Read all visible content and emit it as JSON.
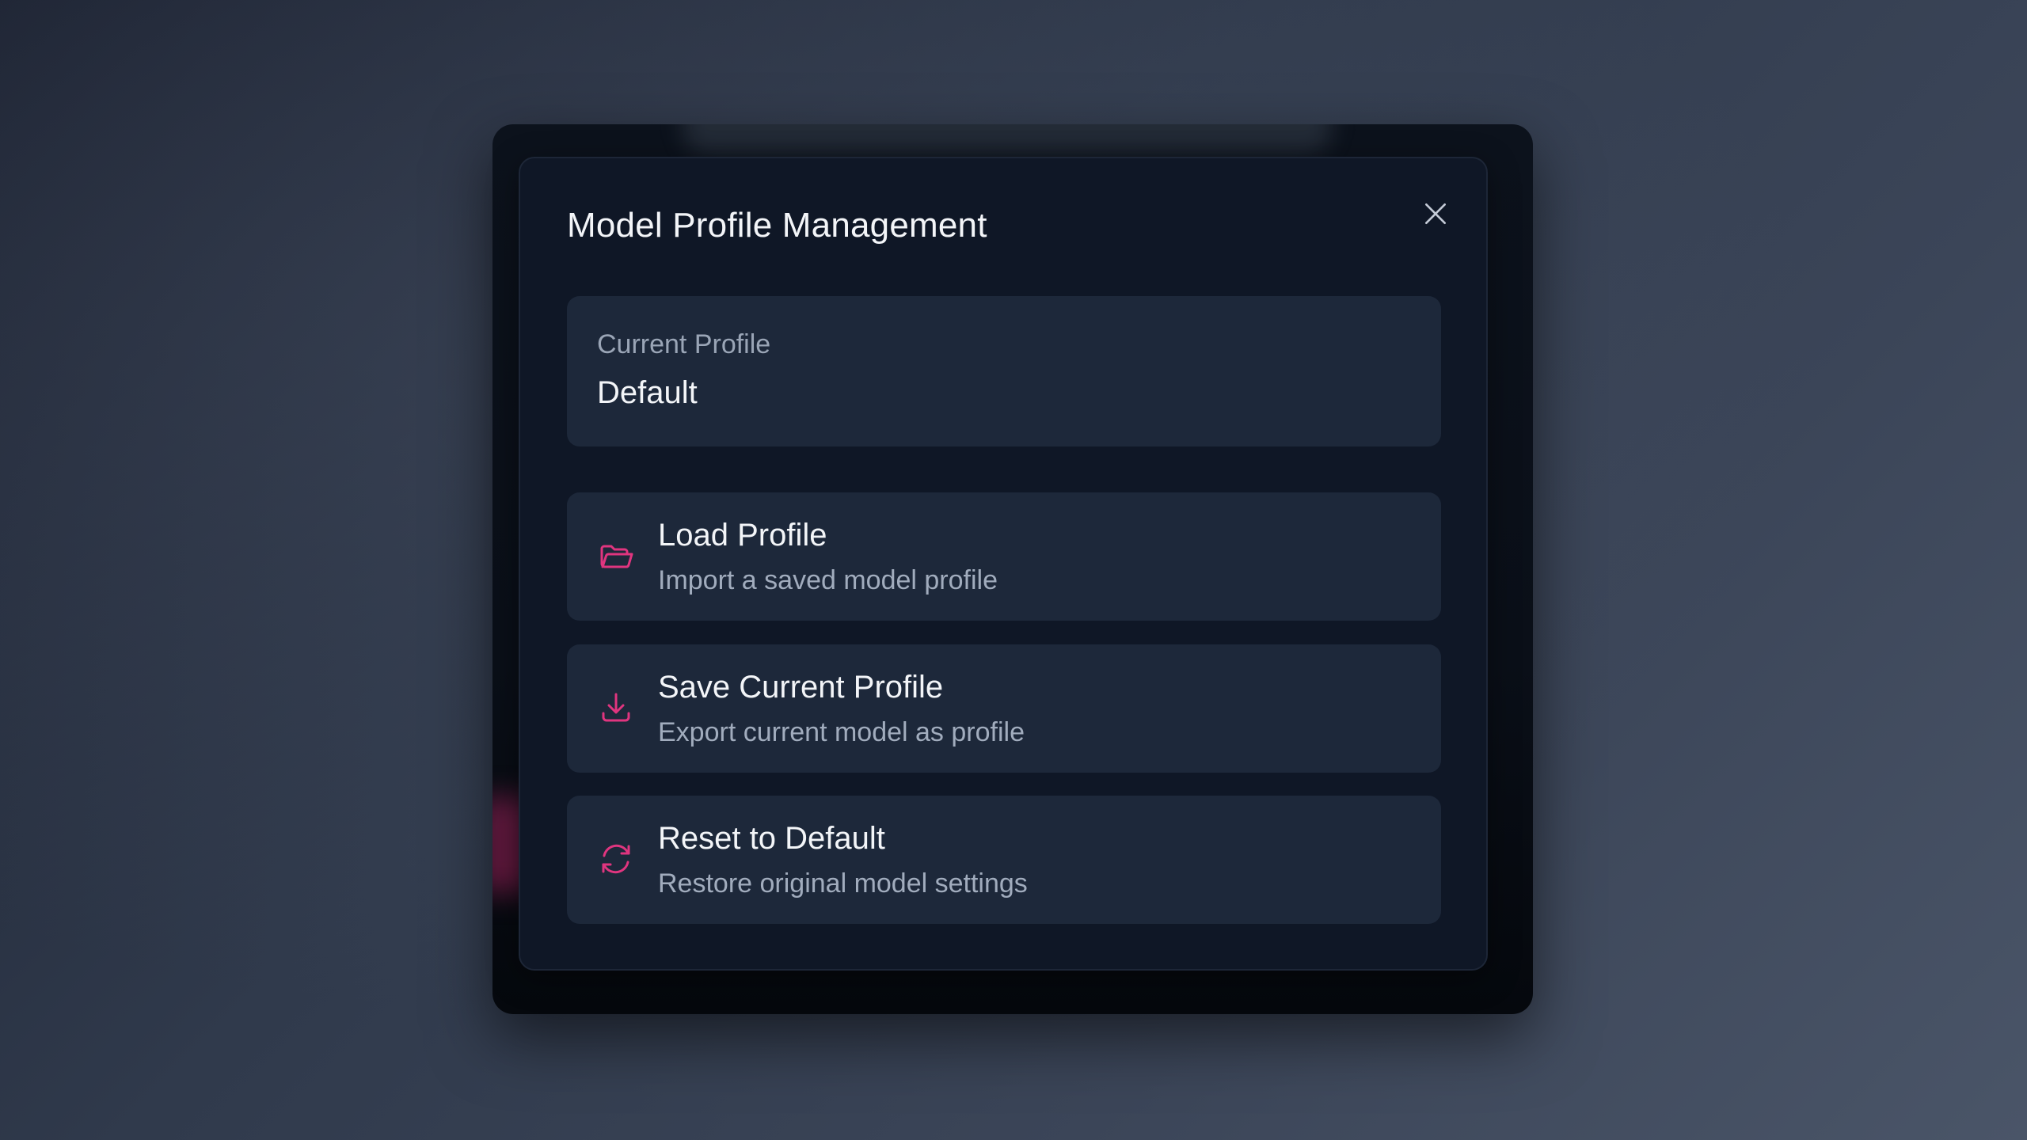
{
  "dialog": {
    "title": "Model Profile Management",
    "close_icon": "close-icon"
  },
  "current_profile": {
    "label": "Current Profile",
    "value": "Default"
  },
  "actions": [
    {
      "title": "Load Profile",
      "description": "Import a saved model profile",
      "icon": "folder-open-icon"
    },
    {
      "title": "Save Current Profile",
      "description": "Export current model as profile",
      "icon": "download-icon"
    },
    {
      "title": "Reset to Default",
      "description": "Restore original model settings",
      "icon": "refresh-icon"
    }
  ],
  "colors": {
    "accent": "#e0357f",
    "dialog_bg": "#0f1726",
    "card_bg": "#1d283a",
    "text_primary": "#f3f5f8",
    "text_secondary": "#a1acbd"
  }
}
